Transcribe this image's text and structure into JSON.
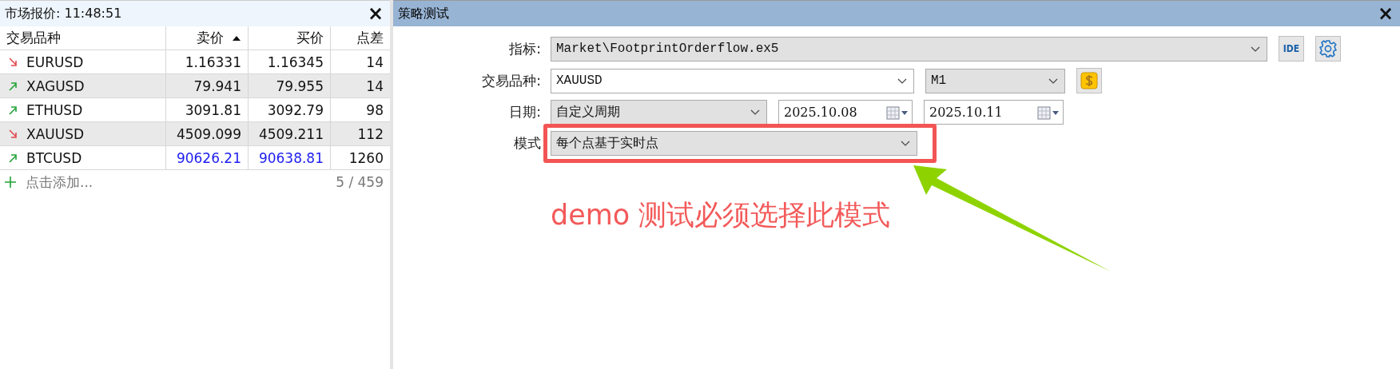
{
  "market_watch": {
    "title": "市场报价: 11:48:51",
    "close": "×",
    "columns": [
      {
        "label": "交易品种",
        "sorted": false
      },
      {
        "label": "卖价",
        "sorted": true
      },
      {
        "label": "买价",
        "sorted": false
      },
      {
        "label": "点差",
        "sorted": false
      }
    ],
    "rows": [
      {
        "symbol": "EURUSD",
        "kind": "down",
        "bid": "1.16331",
        "ask": "1.16345",
        "spread": "14",
        "highlighted": false
      },
      {
        "symbol": "XAGUSD",
        "kind": "up",
        "bid": "79.941",
        "ask": "79.955",
        "spread": "14",
        "highlighted": false
      },
      {
        "symbol": "ETHUSD",
        "kind": "up",
        "bid": "3091.81",
        "ask": "3092.79",
        "spread": "98",
        "highlighted": false
      },
      {
        "symbol": "XAUUSD",
        "kind": "down",
        "bid": "4509.099",
        "ask": "4509.211",
        "spread": "112",
        "highlighted": false
      },
      {
        "symbol": "BTCUSD",
        "kind": "up",
        "bid": "90626.21",
        "ask": "90638.81",
        "spread": "1260",
        "highlighted": true
      }
    ],
    "add_label": "点击添加...",
    "count": "5 / 459"
  },
  "strategy_tester": {
    "title": "策略测试",
    "close": "×",
    "indicator": {
      "label": "指标:",
      "value": "Market\\FootprintOrderflow.ex5",
      "ide_button": "IDE"
    },
    "symbol": {
      "label": "交易品种:",
      "value": "XAUUSD",
      "timeframe": "M1"
    },
    "date": {
      "label": "日期:",
      "period": "自定义周期",
      "from": "2025.10.08",
      "to": "2025.10.11"
    },
    "mode": {
      "label": "模式",
      "value": "每个点基于实时点"
    }
  },
  "annotation": {
    "text": "demo 测试必须选择此模式"
  }
}
